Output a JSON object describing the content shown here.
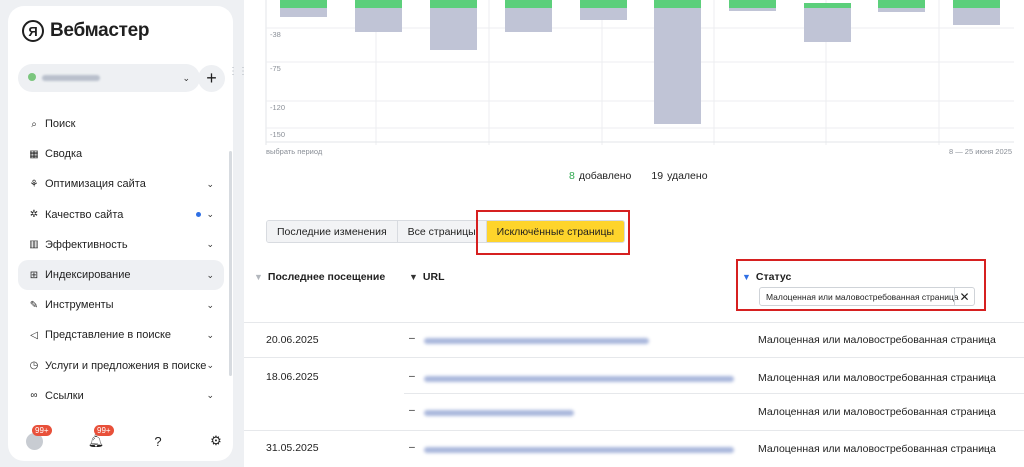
{
  "sidebar": {
    "logo_mark": "Я",
    "logo_text": "Вебмастер",
    "add_label": "+",
    "grip": "⋮⋮",
    "items": [
      {
        "icon": "⌕",
        "label": "Поиск",
        "chevron": ""
      },
      {
        "icon": "▦",
        "label": "Сводка",
        "chevron": ""
      },
      {
        "icon": "⚘",
        "label": "Оптимизация сайта",
        "chevron": "⌄"
      },
      {
        "icon": "✲",
        "label": "Качество сайта",
        "chevron": "⌄"
      },
      {
        "icon": "▥",
        "label": "Эффективность",
        "chevron": "⌄"
      },
      {
        "icon": "⊞",
        "label": "Индексирование",
        "chevron": "⌄"
      },
      {
        "icon": "✎",
        "label": "Инструменты",
        "chevron": "⌄"
      },
      {
        "icon": "◁",
        "label": "Представление в поиске",
        "chevron": "⌄"
      },
      {
        "icon": "◷",
        "label": "Услуги и предложения в поиске",
        "chevron": "⌄"
      },
      {
        "icon": "∞",
        "label": "Ссылки",
        "chevron": "⌄"
      }
    ],
    "bottom": {
      "badge1": "99+",
      "badge2": "99+",
      "bell": "🔔︎",
      "help": "?",
      "gear": "⚙"
    }
  },
  "chart": {
    "y_ticks": [
      "-38",
      "-75",
      "-120",
      "-150"
    ],
    "period_label": "выбрать период",
    "date_range": "8 — 25 июня 2025"
  },
  "stats": {
    "added_num": "8",
    "added_label": "добавлено",
    "removed_num": "19",
    "removed_label": "удалено"
  },
  "tabs": [
    {
      "label": "Последние изменения"
    },
    {
      "label": "Все страницы"
    },
    {
      "label": "Исключённые страницы"
    }
  ],
  "table": {
    "col_last_visit": "Последнее посещение",
    "col_url": "URL",
    "col_status": "Статус",
    "filter_value": "Малоценная или маловостребованная страница",
    "filter_clear": "✕",
    "rows": [
      {
        "date": "20.06.2025",
        "dash": "–",
        "status": "Малоценная или маловостребованная страница",
        "more": "⋯"
      },
      {
        "date": "18.06.2025",
        "dash": "–",
        "status": "Малоценная или маловостребованная страница",
        "more": "⋯"
      },
      {
        "date": "",
        "dash": "–",
        "status": "Малоценная или маловостребованная страница",
        "more": "⋯"
      },
      {
        "date": "31.05.2025",
        "dash": "–",
        "status": "Малоценная или маловостребованная страница",
        "more": "⋯"
      }
    ]
  },
  "colors": {
    "positive_bar": "#5ccf7b",
    "negative_bar": "#c0c4d6",
    "active_tab": "#fed42b",
    "highlight_border": "#d62020",
    "filter_icon": "#2f6fe4"
  }
}
